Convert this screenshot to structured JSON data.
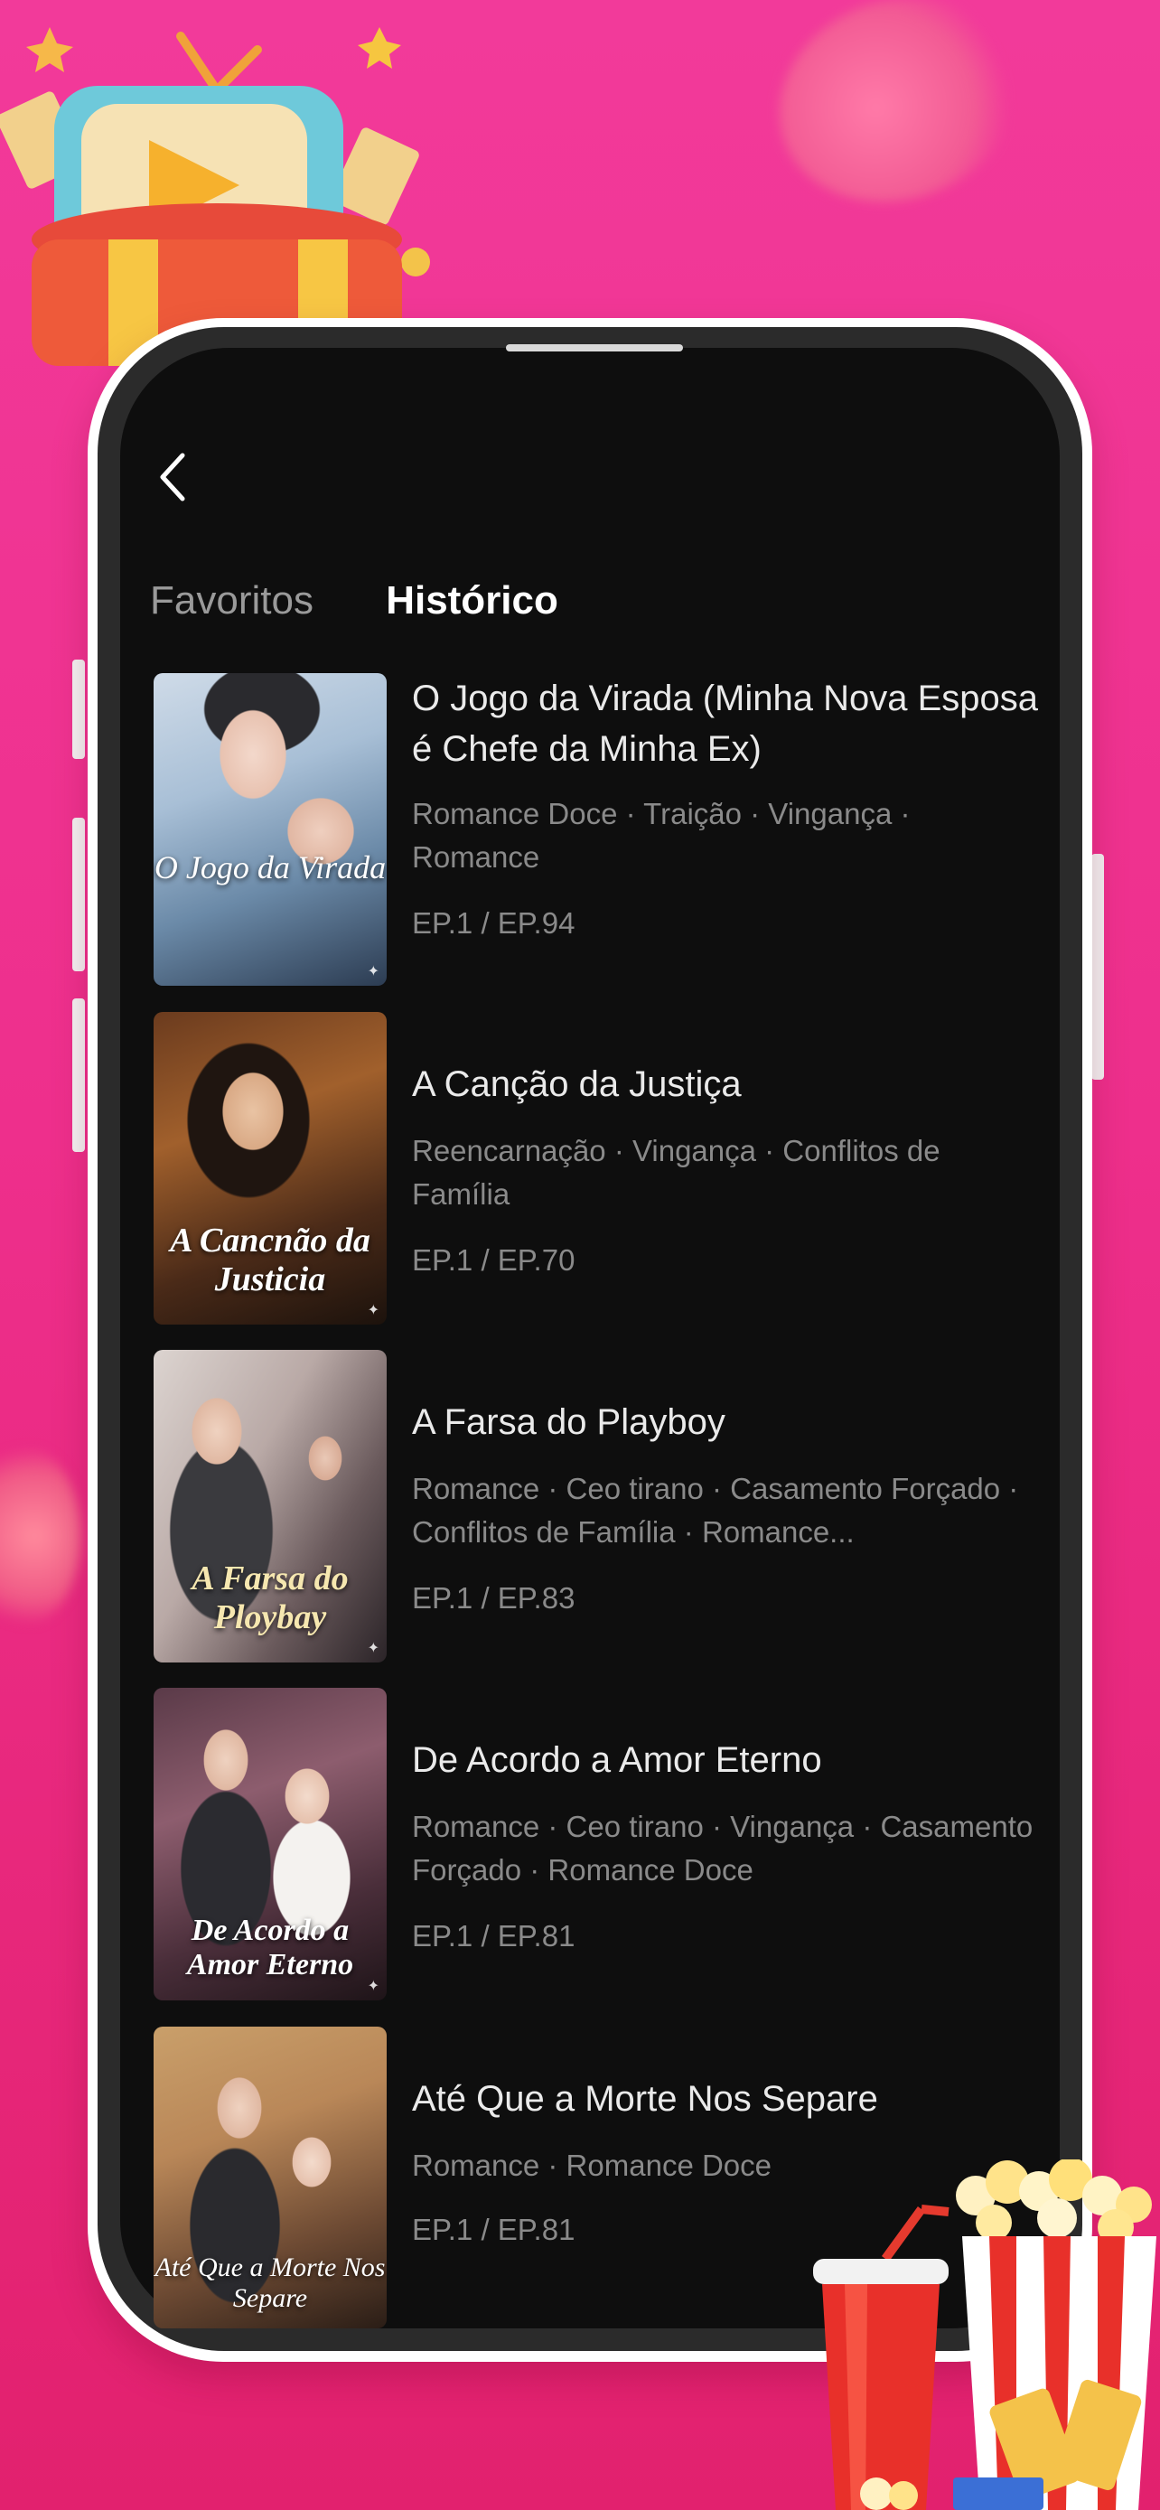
{
  "tabs": {
    "favorites": "Favoritos",
    "history": "Histórico"
  },
  "items": [
    {
      "title": "O Jogo da Virada (Minha Nova Esposa é Chefe da Minha Ex)",
      "tags": "Romance Doce · Traição · Vingança · Romance",
      "episodes": "EP.1 / EP.94",
      "poster_caption": "O Jogo da Virada"
    },
    {
      "title": "A Canção da Justiça",
      "tags": "Reencarnação · Vingança · Conflitos de Família",
      "episodes": "EP.1 / EP.70",
      "poster_caption": "A Cancnão da Justicia"
    },
    {
      "title": "A Farsa do Playboy",
      "tags": "Romance · Ceo tirano · Casamento Forçado · Conflitos de Família · Romance...",
      "episodes": "EP.1 / EP.83",
      "poster_caption": "A Farsa do Ploybay"
    },
    {
      "title": "De Acordo a Amor Eterno",
      "tags": "Romance · Ceo tirano · Vingança · Casamento Forçado · Romance Doce",
      "episodes": "EP.1 / EP.81",
      "poster_caption": "De Acordo a Amor Eterno"
    },
    {
      "title": "Até Que a Morte Nos Separe",
      "tags": "Romance · Romance Doce",
      "episodes": "EP.1 / EP.81",
      "poster_caption": "Até Que a Morte Nos Separe"
    }
  ],
  "colors": {
    "background": "#ee2f8c",
    "screen": "#0e0e0e",
    "active_tab": "#ffffff",
    "inactive_tab": "#9a9a9a"
  }
}
